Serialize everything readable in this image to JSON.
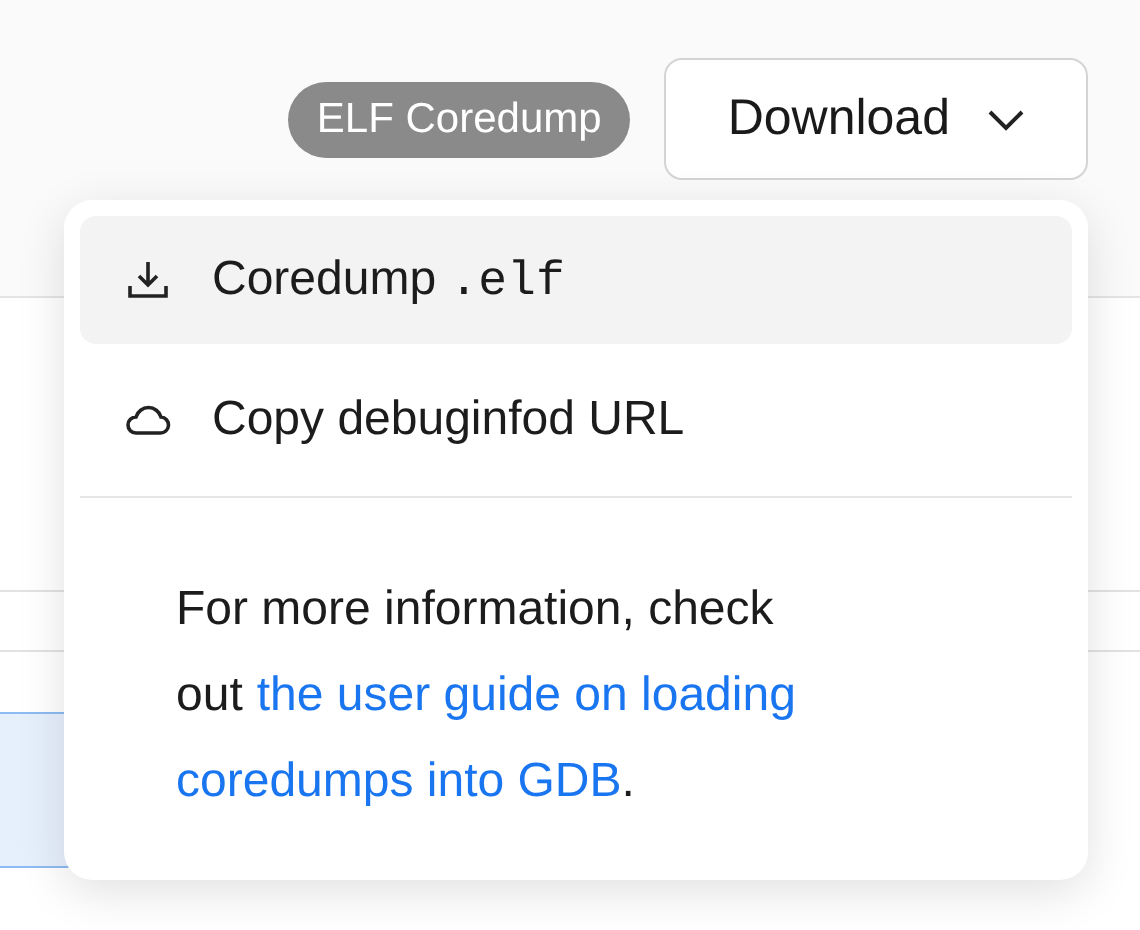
{
  "badge": "ELF Coredump",
  "download_button": {
    "label": "Download",
    "expanded": true
  },
  "menu": {
    "items": [
      {
        "kind": "download",
        "label": "Coredump",
        "code": ".elf",
        "highlighted": true
      },
      {
        "kind": "cloud",
        "label": "Copy debuginfod URL",
        "highlighted": false
      }
    ],
    "note": {
      "lines": [
        [
          {
            "kind": "text",
            "text": "For more information, check"
          }
        ],
        [
          {
            "kind": "text",
            "text": "out"
          },
          {
            "kind": "link",
            "text": "the user guide on loading"
          }
        ],
        [
          {
            "kind": "link",
            "text": "coredumps into GDB"
          },
          {
            "kind": "text",
            "text": "."
          }
        ]
      ]
    }
  }
}
